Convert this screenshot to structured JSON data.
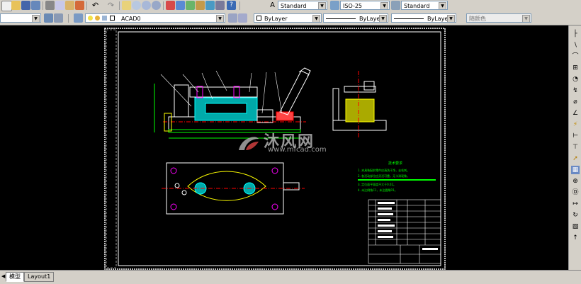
{
  "toolbar": {
    "text_style": "Standard",
    "dim_style": "ISO-25",
    "table_style": "Standard",
    "layer": "ACAD0",
    "color": "ByLayer",
    "linetype": "ByLayer",
    "lineweight": "ByLayer",
    "plot_style": "随颜色"
  },
  "drawing": {
    "tech_title": "技术要求",
    "tech_lines": [
      "1. 夹具装配前零件应清洗干净，去毛刺。",
      "2. 各活动部位应灵活可靠，无卡滞现象。",
      "3. 定位面平面度不大于0.02。",
      "4. 未注倒角C1，未注圆角R1。"
    ]
  },
  "watermark": {
    "cn": "沐风网",
    "url": "www.mfcad.com"
  },
  "tabs": {
    "model": "模型",
    "layout1": "Layout1"
  },
  "colors": {
    "canvas": "#000000",
    "cad_green": "#00ff00",
    "cad_white": "#ffffff",
    "cad_yellow": "#ffff00",
    "cad_cyan": "#00ffff",
    "cad_red": "#ff0000"
  }
}
